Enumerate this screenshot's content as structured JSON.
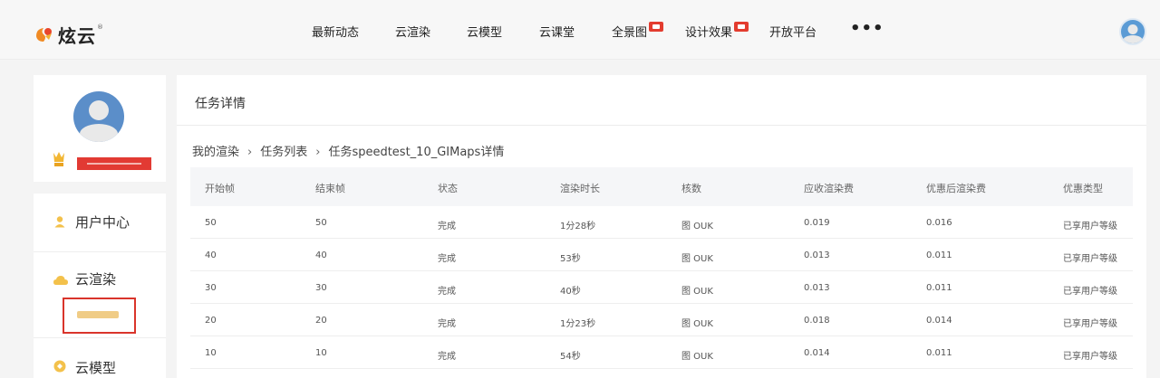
{
  "brand": {
    "name": "炫云",
    "reg": "®"
  },
  "nav": {
    "items": [
      {
        "label": "最新动态",
        "badge": false
      },
      {
        "label": "云渲染",
        "badge": false
      },
      {
        "label": "云模型",
        "badge": false
      },
      {
        "label": "云课堂",
        "badge": false
      },
      {
        "label": "全景图",
        "badge": true
      },
      {
        "label": "设计效果",
        "badge": true
      },
      {
        "label": "开放平台",
        "badge": false
      }
    ],
    "more": "•••"
  },
  "sidebar": {
    "menu": [
      {
        "label": "用户中心",
        "icon": "user-icon"
      },
      {
        "label": "云渲染",
        "icon": "cloud-icon"
      },
      {
        "label": "云模型",
        "icon": "model-icon"
      }
    ]
  },
  "main": {
    "title": "任务详情",
    "breadcrumb": [
      "我的渲染",
      "任务列表",
      "任务speedtest_10_GIMaps详情"
    ],
    "columns": [
      "开始帧",
      "结束帧",
      "状态",
      "渲染时长",
      "核数",
      "应收渲染费",
      "优惠后渲染费",
      "优惠类型"
    ],
    "rows": [
      [
        "50",
        "50",
        "完成",
        "1分28秒",
        "图 OUK",
        "0.019",
        "0.016",
        "已享用户等级"
      ],
      [
        "40",
        "40",
        "完成",
        "53秒",
        "图 OUK",
        "0.013",
        "0.011",
        "已享用户等级"
      ],
      [
        "30",
        "30",
        "完成",
        "40秒",
        "图 OUK",
        "0.013",
        "0.011",
        "已享用户等级"
      ],
      [
        "20",
        "20",
        "完成",
        "1分23秒",
        "图 OUK",
        "0.018",
        "0.014",
        "已享用户等级"
      ],
      [
        "10",
        "10",
        "完成",
        "54秒",
        "图 OUK",
        "0.014",
        "0.011",
        "已享用户等级"
      ]
    ]
  }
}
